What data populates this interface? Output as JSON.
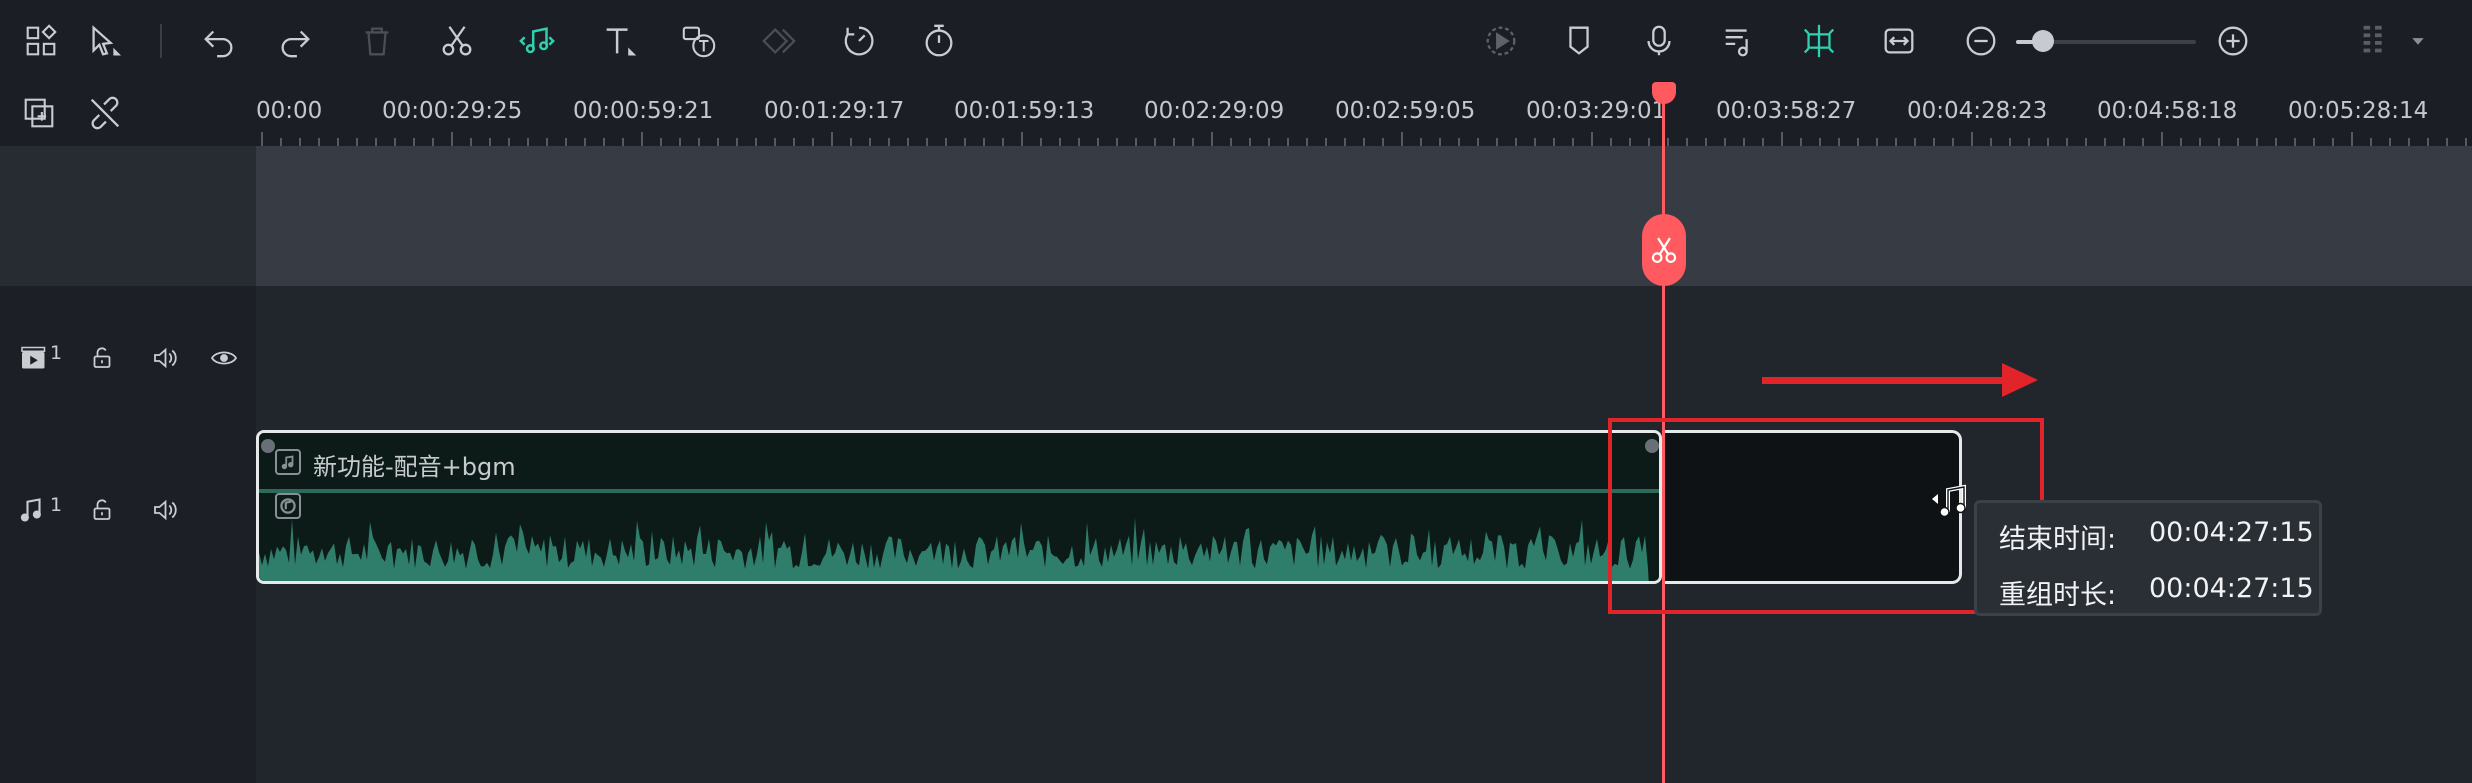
{
  "ruler": {
    "labels": [
      "00:00",
      "00:00:29:25",
      "00:00:59:21",
      "00:01:29:17",
      "00:01:59:13",
      "00:02:29:09",
      "00:02:59:05",
      "00:03:29:01",
      "00:03:58:27",
      "00:04:28:23",
      "00:04:58:18",
      "00:05:28:14"
    ]
  },
  "tracks": {
    "video": {
      "number": "1"
    },
    "audio": {
      "number": "1"
    }
  },
  "clip": {
    "title": "新功能-配音+bgm"
  },
  "tooltip": {
    "end_label": "结束时间:",
    "end_value": "00:04:27:15",
    "duration_label": "重组时长:",
    "duration_value": "00:04:27:15"
  },
  "zoom": {
    "level": 0.15
  },
  "colors": {
    "accent": "#2fd1b0",
    "playhead": "#ff5a5f",
    "annotation": "#e0242a",
    "waveform": "#2f7e6b"
  }
}
